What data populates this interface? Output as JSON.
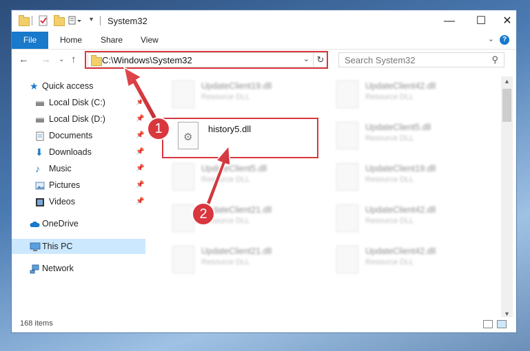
{
  "window": {
    "title": "System32",
    "controls": {
      "minimize": "—",
      "maximize": "☐",
      "close": "✕"
    }
  },
  "ribbon": {
    "tabs": [
      "File",
      "Home",
      "Share",
      "View"
    ],
    "help": "?"
  },
  "navigation": {
    "address": "C:\\Windows\\System32",
    "search_placeholder": "Search System32"
  },
  "sidebar": {
    "items": [
      {
        "label": "Quick access",
        "icon": "star-icon"
      },
      {
        "label": "Local Disk (C:)",
        "icon": "drive-icon",
        "pinned": true
      },
      {
        "label": "Local Disk (D:)",
        "icon": "drive-icon",
        "pinned": true
      },
      {
        "label": "Documents",
        "icon": "documents-icon",
        "pinned": true
      },
      {
        "label": "Downloads",
        "icon": "download-icon",
        "pinned": true
      },
      {
        "label": "Music",
        "icon": "music-icon",
        "pinned": true
      },
      {
        "label": "Pictures",
        "icon": "pictures-icon",
        "pinned": true
      },
      {
        "label": "Videos",
        "icon": "videos-icon",
        "pinned": true
      },
      {
        "label": "OneDrive",
        "icon": "cloud-icon"
      },
      {
        "label": "This PC",
        "icon": "computer-icon",
        "selected": true
      },
      {
        "label": "Network",
        "icon": "network-icon"
      }
    ]
  },
  "files": {
    "highlighted": {
      "name": "history5.dll"
    },
    "blurred": [
      {
        "name": "UpdateClient19.dll",
        "type": "Resource DLL"
      },
      {
        "name": "UpdateClient42.dll",
        "type": "Resource DLL"
      },
      {
        "name": "UpdateClient5.dll",
        "type": "Resource DLL"
      },
      {
        "name": "UpdateClient5.dll",
        "type": "Resource DLL"
      },
      {
        "name": "UpdateClient19.dll",
        "type": "Resource DLL"
      },
      {
        "name": "UpdateClient21.dll",
        "type": "Resource DLL"
      },
      {
        "name": "UpdateClient42.dll",
        "type": "Resource DLL"
      },
      {
        "name": "UpdateClient21.dll",
        "type": "Resource DLL"
      },
      {
        "name": "UpdateClient42.dll",
        "type": "Resource DLL"
      }
    ]
  },
  "status": {
    "item_count": "168 items"
  },
  "annotations": {
    "step1": "1",
    "step2": "2"
  },
  "colors": {
    "accent": "#1979ca",
    "highlight_red": "#d9363e",
    "selected": "#cce8ff"
  }
}
